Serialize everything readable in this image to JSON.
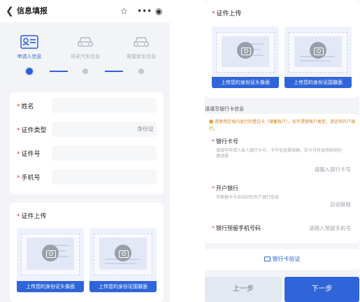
{
  "left": {
    "header": {
      "back_icon": "chevron-left-icon",
      "title": "信息填报",
      "star_icon": "star-icon",
      "more_icon": "more-dots-icon",
      "target_icon": "target-icon"
    },
    "steps": [
      {
        "label": "申请人信息",
        "icon": "id-card-icon",
        "active": true
      },
      {
        "label": "将采汽车信息",
        "icon": "car-icon",
        "active": false
      },
      {
        "label": "需置新车信息",
        "icon": "car-icon",
        "active": false
      }
    ],
    "form": {
      "fields": [
        {
          "label": "姓名",
          "required": true,
          "value": ""
        },
        {
          "label": "证件类型",
          "required": true,
          "value": "身份证"
        },
        {
          "label": "证件号",
          "required": true,
          "value": ""
        },
        {
          "label": "手机号",
          "required": true,
          "value": ""
        }
      ]
    },
    "upload": {
      "title": "证件上传",
      "front_button": "上传您的身份证头像面",
      "back_button": "上传您的身份证国徽面"
    }
  },
  "right": {
    "upload": {
      "title": "证件上传",
      "front_button": "上传您的身份证头像面",
      "back_button": "上传您的身份证国徽面"
    },
    "bank_section_title": "请填写银行卡信息",
    "notice": "请使用在境内发行的借记卡（储蓄账户），如不清楚账户类型，请咨询开户银行。",
    "bank_card": {
      "label": "银行卡号",
      "hint": "请填写申请人本人银行卡号，卡号信息需准确，若卡号有误将影响办理进度",
      "placeholder": "请输入银行卡号"
    },
    "bank_name": {
      "label": "开户银行",
      "hint": "可根据卡号自动识别开户银行信息",
      "placeholder": "自动获取"
    },
    "bank_phone": {
      "label": "银行预留手机号码",
      "placeholder": "请输入预留手机号"
    },
    "verify_button": "银行卡验证",
    "prev_button": "上一步",
    "next_button": "下一步"
  }
}
